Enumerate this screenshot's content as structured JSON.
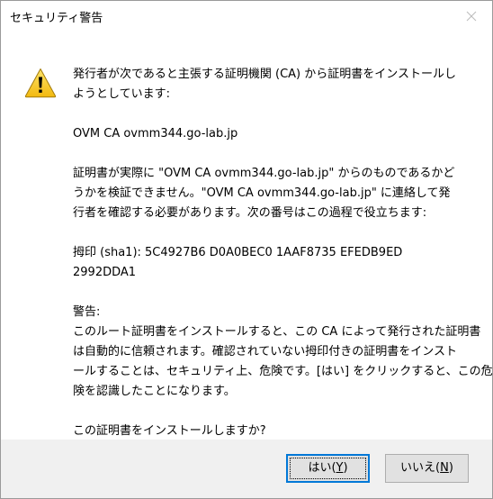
{
  "window": {
    "title": "セキュリティ警告"
  },
  "icons": {
    "warning": "warning-icon",
    "close": "close-icon"
  },
  "message": {
    "intro": [
      "発行者が次であると主張する証明機関 (CA) から証明書をインストールし",
      "ようとしています:"
    ],
    "ca_name": "OVM CA ovmm344.go-lab.jp",
    "verify": [
      "証明書が実際に \"OVM CA ovmm344.go-lab.jp\" からのものであるかど",
      "うかを検証できません。\"OVM CA ovmm344.go-lab.jp\" に連絡して発",
      "行者を確認する必要があります。次の番号はこの過程で役立ちます:"
    ],
    "thumbprint": [
      "拇印 (sha1): 5C4927B6 D0A0BEC0 1AAF8735 EFEDB9ED",
      "2992DDA1"
    ],
    "warning_heading": "警告:",
    "warning_body": [
      "このルート証明書をインストールすると、この CA によって発行された証明書",
      "は自動的に信頼されます。確認されていない拇印付きの証明書をインスト",
      "ールすることは、セキュリティ上、危険です。[はい] をクリックすると、この危",
      "険を認識したことになります。"
    ],
    "question": "この証明書をインストールしますか?"
  },
  "buttons": {
    "yes": {
      "label": "はい(",
      "accel": "Y",
      "suffix": ")"
    },
    "no": {
      "label": "いいえ(",
      "accel": "N",
      "suffix": ")"
    }
  },
  "colors": {
    "focus_border": "#0078d7",
    "footer_bg": "#f0f0f0",
    "button_bg": "#e1e1e1",
    "warning_yellow": "#f7c61d"
  }
}
